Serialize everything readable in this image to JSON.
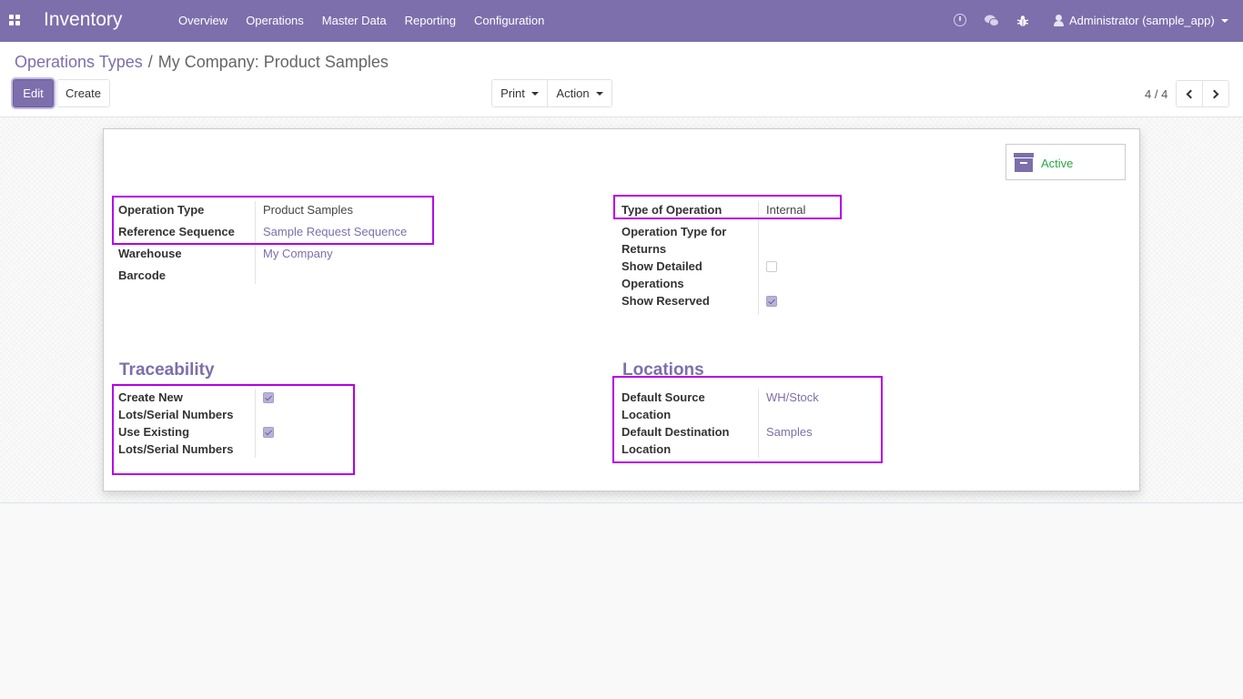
{
  "navbar": {
    "app_name": "Inventory",
    "menu": [
      "Overview",
      "Operations",
      "Master Data",
      "Reporting",
      "Configuration"
    ],
    "user": "Administrator (sample_app)",
    "icons": [
      "apps-icon",
      "clock-icon",
      "chat-icon",
      "bug-icon",
      "user-icon"
    ]
  },
  "breadcrumb": {
    "parent": "Operations Types",
    "separator": "/",
    "current": "My Company: Product Samples"
  },
  "toolbar": {
    "edit_label": "Edit",
    "create_label": "Create",
    "print_label": "Print",
    "action_label": "Action",
    "pager": "4 / 4"
  },
  "form": {
    "status_label": "Active",
    "general": {
      "operation_type_label": "Operation Type",
      "operation_type_value": "Product Samples",
      "reference_sequence_label": "Reference Sequence",
      "reference_sequence_value": "Sample Request Sequence",
      "warehouse_label": "Warehouse",
      "warehouse_value": "My Company",
      "barcode_label": "Barcode",
      "barcode_value": ""
    },
    "type": {
      "type_of_operation_label": "Type of Operation",
      "type_of_operation_value": "Internal",
      "returns_label_1": "Operation Type for",
      "returns_label_2": "Returns",
      "show_detailed_label_1": "Show Detailed",
      "show_detailed_label_2": "Operations",
      "show_detailed_checked": false,
      "show_reserved_label": "Show Reserved",
      "show_reserved_checked": true
    },
    "traceability": {
      "title": "Traceability",
      "create_new_label_1": "Create New",
      "create_new_label_2": "Lots/Serial Numbers",
      "create_new_checked": true,
      "use_existing_label_1": "Use Existing",
      "use_existing_label_2": "Lots/Serial Numbers",
      "use_existing_checked": true
    },
    "locations": {
      "title": "Locations",
      "default_source_label_1": "Default Source",
      "default_source_label_2": "Location",
      "default_source_value": "WH/Stock",
      "default_destination_label_1": "Default Destination",
      "default_destination_label_2": "Location",
      "default_destination_value": "Samples"
    }
  },
  "colors": {
    "brand": "#7c6fac",
    "highlight": "#b300e6",
    "active": "#28a745"
  }
}
